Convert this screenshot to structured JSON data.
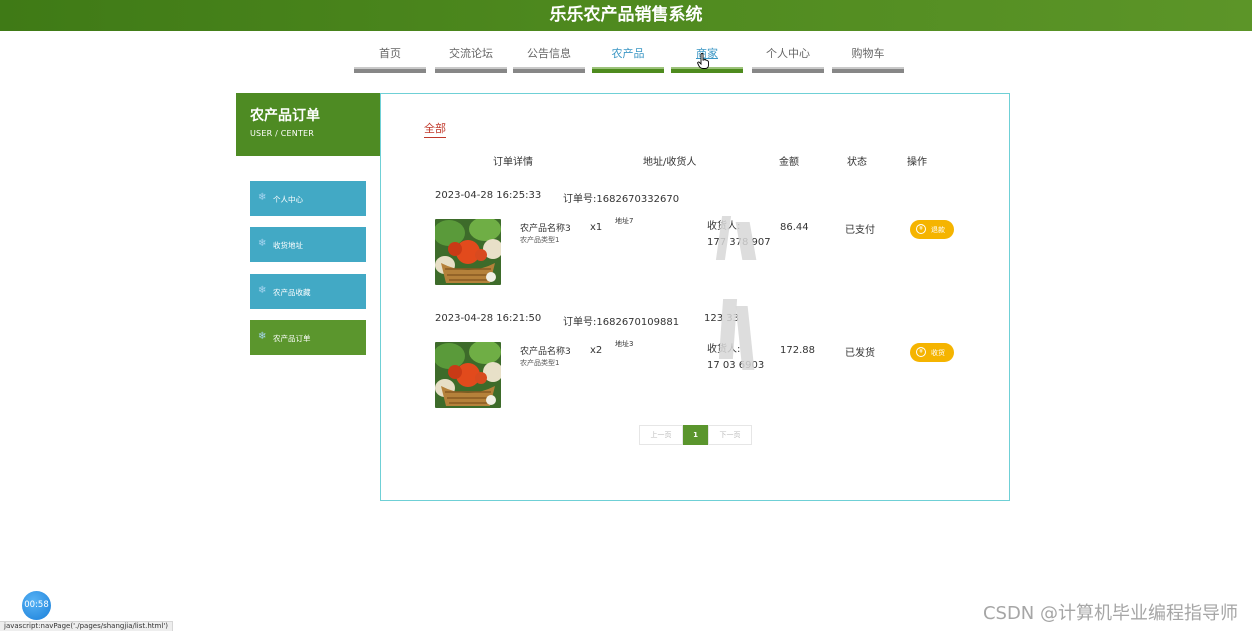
{
  "header": {
    "title": "乐乐农产品销售系统"
  },
  "nav": {
    "items": [
      {
        "label": "首页"
      },
      {
        "label": "交流论坛"
      },
      {
        "label": "公告信息"
      },
      {
        "label": "农产品"
      },
      {
        "label": "商家"
      },
      {
        "label": "个人中心"
      },
      {
        "label": "购物车"
      }
    ],
    "active_index": 3
  },
  "sidebar": {
    "title": "农产品订单",
    "subtitle": "USER / CENTER",
    "items": [
      {
        "label": "个人中心"
      },
      {
        "label": "收货地址"
      },
      {
        "label": "农产品收藏"
      },
      {
        "label": "农产品订单"
      }
    ],
    "active_index": 3
  },
  "orders_panel": {
    "tab_all": "全部",
    "columns": [
      "订单详情",
      "地址/收货人",
      "金额",
      "状态",
      "操作"
    ],
    "orders": [
      {
        "datetime": "2023-04-28 16:25:33",
        "order_no": "订单号:1682670332670",
        "order_no_extra": "",
        "product_name": "农产品名称3",
        "product_type": "农产品类型1",
        "qty": "x1",
        "address": "地址7",
        "receiver": "收货人:",
        "phone": "177 378 907",
        "amount": "86.44",
        "status": "已支付",
        "action": "退款"
      },
      {
        "datetime": "2023-04-28 16:21:50",
        "order_no": "订单号:1682670109881",
        "order_no_extra": "123 33",
        "product_name": "农产品名称3",
        "product_type": "农产品类型1",
        "qty": "x2",
        "address": "地址3",
        "receiver": "收货人:",
        "phone": "17 03 6903",
        "amount": "172.88",
        "status": "已发货",
        "action": "收货"
      }
    ],
    "pager": {
      "prev": "上一页",
      "current": "1",
      "next": "下一页"
    }
  },
  "overlay": {
    "timer": "00:58",
    "status_url": "javascript:navPage('./pages/shangjia/list.html')",
    "watermark": "CSDN @计算机毕业编程指导师"
  },
  "colors": {
    "brand_green": "#4e8b23",
    "sidebar_blue": "#42a9c5",
    "panel_border": "#6fd0d6",
    "action_yellow": "#f5b400",
    "tab_red": "#c0392b"
  }
}
